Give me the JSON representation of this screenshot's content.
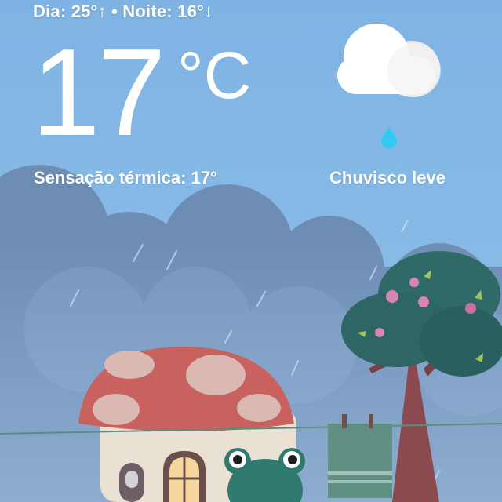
{
  "weather": {
    "day_label": "Dia:",
    "day_temp": "25°",
    "night_label": "Noite:",
    "night_temp": "16°",
    "temperature": "17",
    "unit": "°C",
    "feels_like": "Sensação térmica: 17°",
    "condition": "Chuvisco leve",
    "condition_icon": "light-drizzle-icon"
  },
  "colors": {
    "sky": "#86b9e6",
    "clouds": "#6f8fb6",
    "mushroom_cap": "#c9625f",
    "frog": "#2f7a6e",
    "tree_canopy": "#2e6565",
    "towel": "#5f8f83",
    "drop": "#33c9f0"
  }
}
